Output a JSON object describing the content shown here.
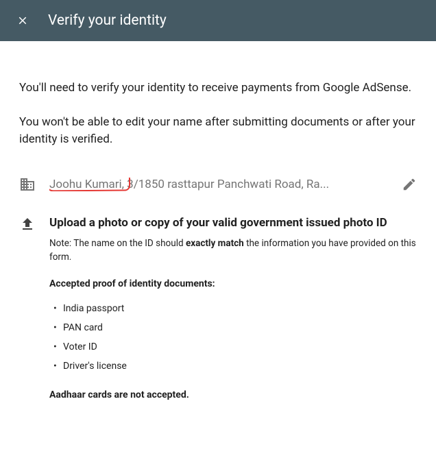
{
  "header": {
    "title": "Verify your identity"
  },
  "intro": "You'll need to verify your identity to receive payments from Google AdSense.",
  "warning": "You won't be able to edit your name after submitting documents or after your identity is verified.",
  "address": {
    "name": "Joohu Kumari",
    "rest": ", 3/1850 rasttapur Panchwati Road, Ra..."
  },
  "upload": {
    "heading": "Upload a photo or copy of your valid government issued photo ID",
    "note_prefix": "Note: The name on the ID should ",
    "note_bold": "exactly match",
    "note_suffix": " the information you have provided on this form.",
    "accepted_heading": "Accepted proof of identity documents:",
    "documents": [
      "India passport",
      "PAN card",
      "Voter ID",
      "Driver's license"
    ],
    "not_accepted": "Aadhaar cards are not accepted."
  }
}
